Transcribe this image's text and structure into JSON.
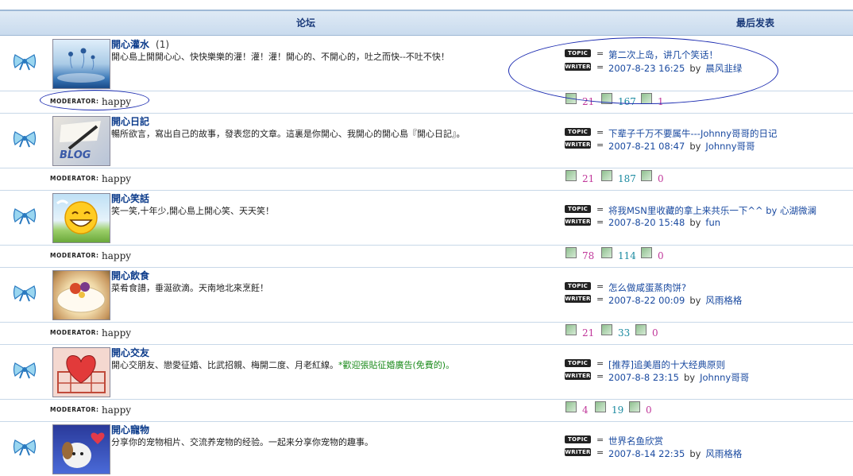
{
  "header": {
    "forum_col": "论坛",
    "last_post_col": "最后发表"
  },
  "labels": {
    "topic_badge": "TOPIC",
    "writer_badge": "WRITER",
    "moderator_label": "MODERATOR:",
    "eq": "=",
    "by": "by"
  },
  "forums": [
    {
      "title": "開心灌水",
      "count": "(1)",
      "desc": "開心島上開開心心、快快樂樂的灌！灌！灌！開心的、不開心的，吐之而快--不吐不快！",
      "desc_extra": "",
      "last_topic": "第二次上岛，讲几个笑话！",
      "last_date": "2007-8-23 16:25",
      "last_author": "晨风韭绿",
      "moderator": "happy",
      "stats": [
        "21",
        "167",
        "1"
      ]
    },
    {
      "title": "開心日記",
      "count": "",
      "desc": "暢所欲言，寫出自己的故事，發表您的文章。這裏是你開心、我開心的開心島『開心日記』。",
      "desc_extra": "",
      "last_topic": "下辈子千万不要属牛---Johnny哥哥的日记",
      "last_date": "2007-8-21 08:47",
      "last_author": "Johnny哥哥",
      "moderator": "happy",
      "stats": [
        "21",
        "187",
        "0"
      ]
    },
    {
      "title": "開心笑話",
      "count": "",
      "desc": "笑一笑,十年少,開心島上開心笑、天天笑！",
      "desc_extra": "",
      "last_topic": "将我MSN里收藏的拿上来共乐一下^^ by 心湖微澜",
      "last_date": "2007-8-20 15:48",
      "last_author": "fun",
      "moderator": "happy",
      "stats": [
        "78",
        "114",
        "0"
      ]
    },
    {
      "title": "開心飲食",
      "count": "",
      "desc": "菜肴食譜，垂涎欲滴。天南地北來烹飪！",
      "desc_extra": "",
      "last_topic": "怎么做咸蛋蒸肉饼?",
      "last_date": "2007-8-22 00:09",
      "last_author": "风雨格格",
      "moderator": "happy",
      "stats": [
        "21",
        "33",
        "0"
      ]
    },
    {
      "title": "開心交友",
      "count": "",
      "desc": "開心交朋友、戀愛征婚、比武招親、梅開二度、月老紅線。",
      "desc_extra": "*歡迎張貼征婚廣告(免費的)。",
      "last_topic": "[推荐]追美眉的十大经典原则",
      "last_date": "2007-8-8 23:15",
      "last_author": "Johnny哥哥",
      "moderator": "happy",
      "stats": [
        "4",
        "19",
        "0"
      ]
    },
    {
      "title": "開心寵物",
      "count": "",
      "desc": "分享你的宠物相片、交流养宠物的经验。一起来分享你宠物的趣事。",
      "desc_extra": "",
      "last_topic": "世界名鱼欣赏",
      "last_date": "2007-8-14 22:35",
      "last_author": "风雨格格",
      "moderator": "",
      "stats": []
    }
  ],
  "colors": {
    "header_bg": "#c9dbee",
    "link": "#1a4aa0",
    "title": "#0a3a8a",
    "ellipse": "#1a2ab0"
  }
}
